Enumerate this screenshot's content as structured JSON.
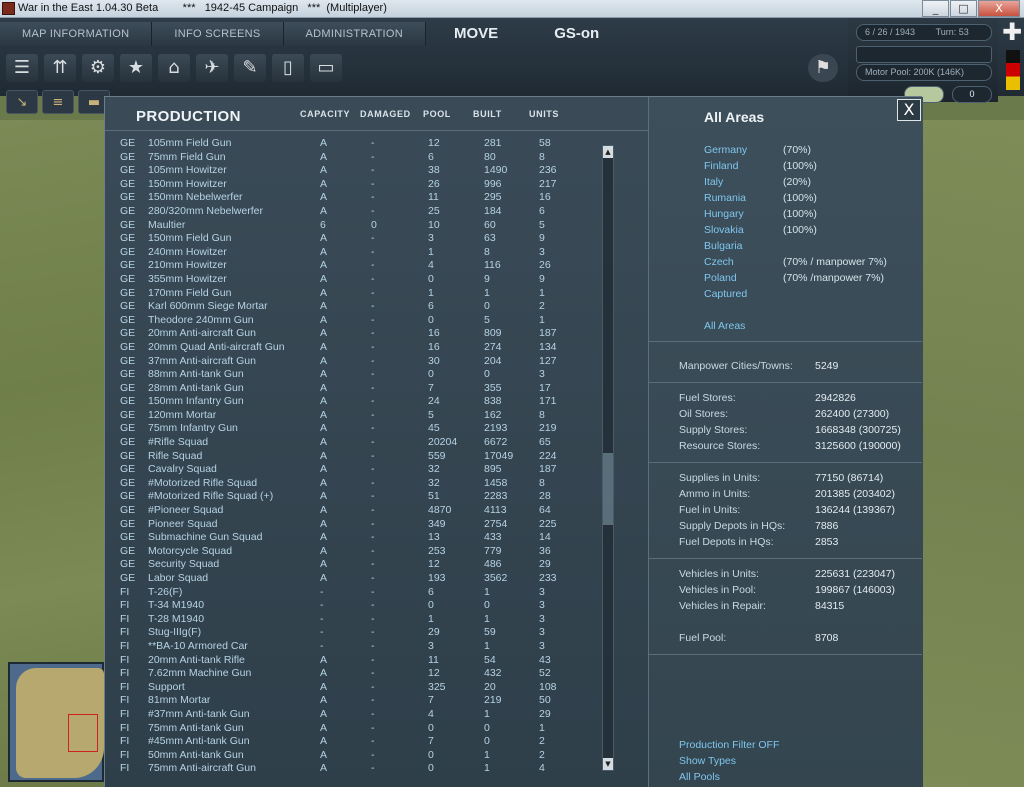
{
  "window": {
    "title": "War in the East 1.04.30 Beta        ***   1942-45 Campaign   ***  (Multiplayer)",
    "min": "_",
    "max": "□",
    "close": "X"
  },
  "menu": {
    "tabs": [
      "MAP INFORMATION",
      "INFO SCREENS",
      "ADMINISTRATION"
    ],
    "move": "MOVE",
    "gs": "GS-on"
  },
  "info": {
    "date": "6 / 26 / 1943",
    "turn": "Turn: 53",
    "motor_pool": "Motor Pool:  200K (146K)",
    "counter": "0"
  },
  "production": {
    "title": "PRODUCTION",
    "headers": {
      "capacity": "CAPACITY",
      "damaged": "DAMAGED",
      "pool": "POOL",
      "built": "BUILT",
      "units": "UNITS"
    },
    "rows": [
      [
        "GE",
        "105mm Field Gun",
        "A",
        "-",
        "12",
        "281",
        "58"
      ],
      [
        "GE",
        "75mm Field Gun",
        "A",
        "-",
        "6",
        "80",
        "8"
      ],
      [
        "GE",
        "105mm Howitzer",
        "A",
        "-",
        "38",
        "1490",
        "236"
      ],
      [
        "GE",
        "150mm Howitzer",
        "A",
        "-",
        "26",
        "996",
        "217"
      ],
      [
        "GE",
        "150mm Nebelwerfer",
        "A",
        "-",
        "11",
        "295",
        "16"
      ],
      [
        "GE",
        "280/320mm Nebelwerfer",
        "A",
        "-",
        "25",
        "184",
        "6"
      ],
      [
        "GE",
        "Maultier",
        "6",
        "0",
        "10",
        "60",
        "5"
      ],
      [
        "GE",
        "150mm Field Gun",
        "A",
        "-",
        "3",
        "63",
        "9"
      ],
      [
        "GE",
        "240mm Howitzer",
        "A",
        "-",
        "1",
        "8",
        "3"
      ],
      [
        "GE",
        "210mm Howitzer",
        "A",
        "-",
        "4",
        "116",
        "26"
      ],
      [
        "GE",
        "355mm Howitzer",
        "A",
        "-",
        "0",
        "9",
        "9"
      ],
      [
        "GE",
        "170mm Field Gun",
        "A",
        "-",
        "1",
        "1",
        "1"
      ],
      [
        "GE",
        "Karl 600mm Siege Mortar",
        "A",
        "-",
        "6",
        "0",
        "2"
      ],
      [
        "GE",
        "Theodore 240mm Gun",
        "A",
        "-",
        "0",
        "5",
        "1"
      ],
      [
        "GE",
        "20mm Anti-aircraft Gun",
        "A",
        "-",
        "16",
        "809",
        "187"
      ],
      [
        "GE",
        "20mm Quad Anti-aircraft Gun",
        "A",
        "-",
        "16",
        "274",
        "134"
      ],
      [
        "GE",
        "37mm Anti-aircraft Gun",
        "A",
        "-",
        "30",
        "204",
        "127"
      ],
      [
        "GE",
        "88mm Anti-tank Gun",
        "A",
        "-",
        "0",
        "0",
        "3"
      ],
      [
        "GE",
        "28mm Anti-tank Gun",
        "A",
        "-",
        "7",
        "355",
        "17"
      ],
      [
        "GE",
        "150mm Infantry Gun",
        "A",
        "-",
        "24",
        "838",
        "171"
      ],
      [
        "GE",
        "120mm Mortar",
        "A",
        "-",
        "5",
        "162",
        "8"
      ],
      [
        "GE",
        "75mm Infantry Gun",
        "A",
        "-",
        "45",
        "2193",
        "219"
      ],
      [
        "GE",
        "#Rifle Squad",
        "A",
        "-",
        "20204",
        "6672",
        "65"
      ],
      [
        "GE",
        "Rifle Squad",
        "A",
        "-",
        "559",
        "17049",
        "224"
      ],
      [
        "GE",
        "Cavalry Squad",
        "A",
        "-",
        "32",
        "895",
        "187"
      ],
      [
        "GE",
        "#Motorized Rifle Squad",
        "A",
        "-",
        "32",
        "1458",
        "8"
      ],
      [
        "GE",
        "#Motorized Rifle Squad (+)",
        "A",
        "-",
        "51",
        "2283",
        "28"
      ],
      [
        "GE",
        "#Pioneer Squad",
        "A",
        "-",
        "4870",
        "4113",
        "64"
      ],
      [
        "GE",
        "Pioneer Squad",
        "A",
        "-",
        "349",
        "2754",
        "225"
      ],
      [
        "GE",
        "Submachine Gun Squad",
        "A",
        "-",
        "13",
        "433",
        "14"
      ],
      [
        "GE",
        "Motorcycle Squad",
        "A",
        "-",
        "253",
        "779",
        "36"
      ],
      [
        "GE",
        "Security Squad",
        "A",
        "-",
        "12",
        "486",
        "29"
      ],
      [
        "GE",
        "Labor Squad",
        "A",
        "-",
        "193",
        "3562",
        "233"
      ],
      [
        "FI",
        "T-26(F)",
        "-",
        "-",
        "6",
        "1",
        "3"
      ],
      [
        "FI",
        "T-34 M1940",
        "-",
        "-",
        "0",
        "0",
        "3"
      ],
      [
        "FI",
        "T-28 M1940",
        "-",
        "-",
        "1",
        "1",
        "3"
      ],
      [
        "FI",
        "Stug-IIIg(F)",
        "-",
        "-",
        "29",
        "59",
        "3"
      ],
      [
        "FI",
        "**BA-10 Armored Car",
        "-",
        "-",
        "3",
        "1",
        "3"
      ],
      [
        "FI",
        "20mm Anti-tank Rifle",
        "A",
        "-",
        "11",
        "54",
        "43"
      ],
      [
        "FI",
        "7.62mm Machine Gun",
        "A",
        "-",
        "12",
        "432",
        "52"
      ],
      [
        "FI",
        "Support",
        "A",
        "-",
        "325",
        "20",
        "108"
      ],
      [
        "FI",
        "81mm Mortar",
        "A",
        "-",
        "7",
        "219",
        "50"
      ],
      [
        "FI",
        "#37mm Anti-tank Gun",
        "A",
        "-",
        "4",
        "1",
        "29"
      ],
      [
        "FI",
        "75mm Anti-tank Gun",
        "A",
        "-",
        "0",
        "0",
        "1"
      ],
      [
        "FI",
        "#45mm Anti-tank Gun",
        "A",
        "-",
        "7",
        "0",
        "2"
      ],
      [
        "FI",
        "50mm Anti-tank Gun",
        "A",
        "-",
        "0",
        "1",
        "2"
      ],
      [
        "FI",
        "75mm Anti-aircraft Gun",
        "A",
        "-",
        "0",
        "1",
        "4"
      ]
    ]
  },
  "areas": {
    "title": "All Areas",
    "close": "X",
    "list": [
      {
        "name": "Germany",
        "pct": "(70%)"
      },
      {
        "name": "Finland",
        "pct": "(100%)"
      },
      {
        "name": "Italy",
        "pct": "(20%)"
      },
      {
        "name": "Rumania",
        "pct": "(100%)"
      },
      {
        "name": "Hungary",
        "pct": "(100%)"
      },
      {
        "name": "Slovakia",
        "pct": "(100%)"
      },
      {
        "name": "Bulgaria",
        "pct": ""
      },
      {
        "name": "Czech",
        "pct": "(70% / manpower 7%)"
      },
      {
        "name": "Poland",
        "pct": "(70% /manpower 7%)"
      },
      {
        "name": "Captured",
        "pct": ""
      }
    ],
    "all_areas_link": "All Areas"
  },
  "stats": {
    "manpower": [
      {
        "label": "Manpower Cities/Towns:",
        "value": "5249"
      }
    ],
    "stores": [
      {
        "label": "Fuel Stores:",
        "value": "2942826"
      },
      {
        "label": "Oil Stores:",
        "value": "262400 (27300)"
      },
      {
        "label": "Supply Stores:",
        "value": "1668348 (300725)"
      },
      {
        "label": "Resource Stores:",
        "value": "3125600 (190000)"
      }
    ],
    "units": [
      {
        "label": "Supplies in Units:",
        "value": "77150 (86714)"
      },
      {
        "label": "Ammo in Units:",
        "value": "201385 (203402)"
      },
      {
        "label": "Fuel in Units:",
        "value": "136244 (139367)"
      },
      {
        "label": "Supply Depots in HQs:",
        "value": "7886"
      },
      {
        "label": "Fuel Depots in HQs:",
        "value": "2853"
      }
    ],
    "vehicles": [
      {
        "label": "Vehicles in Units:",
        "value": "225631 (223047)"
      },
      {
        "label": "Vehicles in Pool:",
        "value": "199867 (146003)"
      },
      {
        "label": "Vehicles in Repair:",
        "value": "84315"
      }
    ],
    "fuel_pool": [
      {
        "label": "Fuel Pool:",
        "value": "8708"
      }
    ]
  },
  "filters": {
    "production_filter": "Production Filter OFF",
    "show_types": "Show Types",
    "all_pools": "All Pools"
  },
  "icons": {
    "toolbar": [
      "list-icon",
      "arrows-icon",
      "gear-icon",
      "star-icon",
      "hq-icon",
      "air-icon",
      "rail-icon",
      "report-icon",
      "notes-icon"
    ],
    "colors": {
      "link": "#7fc7ef",
      "row_text": "#b6d3e4",
      "panel": "#3a4b57"
    }
  }
}
